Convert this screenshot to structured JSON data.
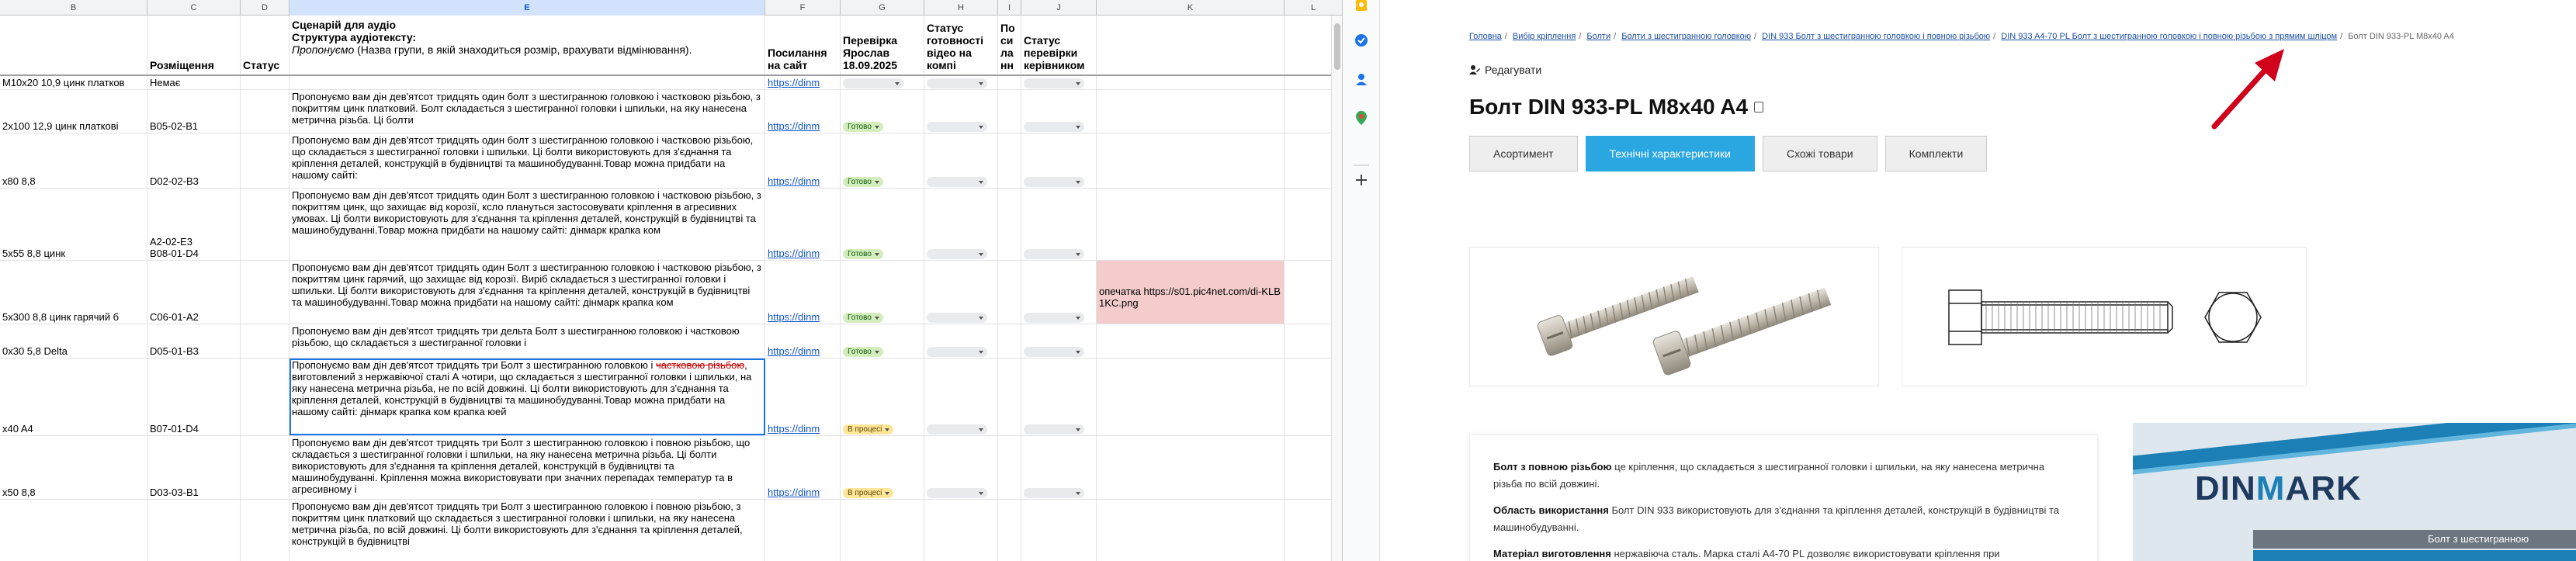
{
  "sheet": {
    "columns": [
      "B",
      "C",
      "D",
      "E",
      "F",
      "G",
      "H",
      "I",
      "J",
      "K",
      "L"
    ],
    "selected_column": "E",
    "header": {
      "c": "Розміщення",
      "d": "Статус",
      "e_line1": "Сценарій для аудіо",
      "e_line2": "Структура аудіотексту:",
      "e_italic": "Пропонуємо",
      "e_rest": " (Назва групи, в якій знаходиться розмір, врахувати відмінювання).",
      "f": "Посилання на сайт",
      "g": "Перевірка Ярослав 18.09.2025",
      "h": "Статус готовності відео на компі",
      "i": "По си ла нн",
      "j": "Статус перевірки керівником"
    },
    "rows": [
      {
        "b": "M10x20 10,9 цинк платков",
        "c": "Немає",
        "e": "",
        "f": "https://dinm",
        "g": "",
        "g_style": "empty"
      },
      {
        "b": "2x100 12,9 цинк платкові",
        "c": "B05-02-B1",
        "e": "Пропонуємо вам дін дев'ятсот тридцять один болт з шестигранною головкою і частковою різьбою, з покриттям цинк платковий. Болт складається з шестигранної головки і шпильки, на яку нанесена метрична різьба. Ці болти",
        "f": "https://dinm",
        "g": "Готово",
        "g_style": "ok"
      },
      {
        "b": "x80 8,8",
        "c": "D02-02-B3",
        "e": "Пропонуємо вам дін дев'ятсот тридцять один болт з шестигранною головкою і частковою різьбою, що складається з шестигранної головки і шпильки. Ці болти використовують для з'єднання та кріплення деталей, конструкцій в будівництві та машинобудуванні.Товар можна придбати на нашому сайті:",
        "f": "https://dinm",
        "g": "Готово",
        "g_style": "ok"
      },
      {
        "b": "5x55 8,8 цинк",
        "c": "A2-02-E3\nB08-01-D4",
        "e": "Пропонуємо вам дін дев'ятсот тридцять один Болт з шестигранною головкою і частковою різьбою, з покриттям цинк, що захищає від корозії, ксло плануться застосовувати кріплення в агресивних умовах. Ці болти використовують для з'єднання та кріплення деталей, конструкцій в будівництві та машинобудуванні.Товар можна придбати на нашому сайті: дінмарк крапка ком",
        "f": "https://dinm",
        "g": "Готово",
        "g_style": "ok"
      },
      {
        "b": "5x300 8,8 цинк гарячий б",
        "c": "C06-01-A2",
        "e": "Пропонуємо вам дін дев'ятсот тридцять один Болт з шестигранною головкою і частковою різьбою, з покриттям цинк гарячий, що захищає від корозії. Виріб складається з шестигранної головки і шпильки. Ці болти використовують для з'єднання та кріплення деталей, конструкцій в будівництві та машинобудуванні.Товар можна придбати на нашому сайті: дінмарк крапка ком",
        "f": "https://dinm",
        "g": "Готово",
        "g_style": "ok",
        "k": "опечатка https://s01.pic4net.com/di-KLB 1KC.png"
      },
      {
        "b": "0x30 5,8 Delta",
        "c": "D05-01-B3",
        "e": "Пропонуємо вам дін дев'ятсот тридцять три дельта Болт з шестигранною головкою і частковою різьбою, що складається з шестигранної головки і",
        "f": "https://dinm",
        "g": "Готово",
        "g_style": "ok"
      },
      {
        "b": "x40 A4",
        "c": "B07-01-D4",
        "e_pre": "Пропонуємо вам дін дев'ятсот тридцять три Болт з шестигранною головкою і ",
        "e_strike": "частковою різьбою",
        "e_post": ", виготовлений з нержавіючої сталі А чотири, що складається з шестигранної головки і шпильки, на яку нанесена метрична різьба, не по всій довжині. Ці болти використовують для з'єднання та кріплення деталей, конструкцій в будівництві та машинобудуванні.Товар можна придбати на нашому сайті: дінмарк крапка ком крапка юей",
        "f": "https://dinm",
        "g": "В процесі",
        "g_style": "prog"
      },
      {
        "b": "x50 8,8",
        "c": "D03-03-B1",
        "e": "Пропонуємо вам дін дев'ятсот тридцять три Болт з шестигранною головкою і повною різьбою, що складається з шестигранної головки і шпильки, на яку нанесена метрична різьба. Ці болти використовують для з'єднання та кріплення деталей, конструкцій в будівництві та машинобудуванні. Кріплення можна використовувати при значних перепадах температур та в агресивному і",
        "f": "https://dinm",
        "g": "В процесі",
        "g_style": "prog"
      },
      {
        "b": "",
        "c": "",
        "e": "Пропонуємо вам дін дев'ятсот тридцять три Болт з шестигранною головкою і повною різьбою, з покриттям цинк платковий що складається з шестигранної головки і шпильки, на яку нанесена метрична різьба, по всій довжині. Ці болти використовують для з'єднання та кріплення деталей, конструкцій в будівництві",
        "f": "",
        "g": "",
        "g_style": "none"
      }
    ]
  },
  "sidepanel": {
    "icons": [
      "keep-icon",
      "tasks-icon",
      "contacts-icon",
      "maps-icon",
      "add-icon"
    ],
    "colors": {
      "keep": "#fbbc04",
      "tasks": "#1a73e8",
      "contacts": "#1a73e8",
      "maps": "#34a853"
    }
  },
  "site": {
    "breadcrumbs": [
      "Головна",
      "Вибір кріплення",
      "Болти",
      "Болти з шестигранною головкою",
      "DIN 933 Болт з шестигранною головкою і повною різьбою",
      "DIN 933 A4-70 PL Болт з шестигранною головкою і повною різьбою з прямим шліцом"
    ],
    "breadcrumb_current": "Болт DIN 933-PL M8x40 A4",
    "edit_label": "Редагувати",
    "title": "Болт DIN 933-PL M8x40 A4",
    "tabs": [
      "Асортимент",
      "Технічні характеристики",
      "Схожі товари",
      "Комплекти"
    ],
    "active_tab": 1,
    "description": {
      "p1_bold": "Болт з повною різьбою",
      "p1_rest": " це кріплення, що складається з шестигранної головки і шпильки, на яку нанесена метрична різьба по всій довжині.",
      "p2_bold": "Область використання",
      "p2_rest": " Болт DIN 933 використовують для з'єднання та кріплення деталей, конструкцій в будівництві та машинобудуванні.",
      "p3_bold": "Матеріал виготовлення",
      "p3_rest": " нержавіюча сталь. Марка сталі A4-70 PL дозволяє використовувати кріплення при"
    },
    "banner": {
      "logo_a": "DIN",
      "logo_b": "M",
      "logo_c": "ARK",
      "strip_text": "Болт з шестигранною"
    },
    "accent_color": "#2aa7e0",
    "arrow_color": "#d0021b"
  }
}
